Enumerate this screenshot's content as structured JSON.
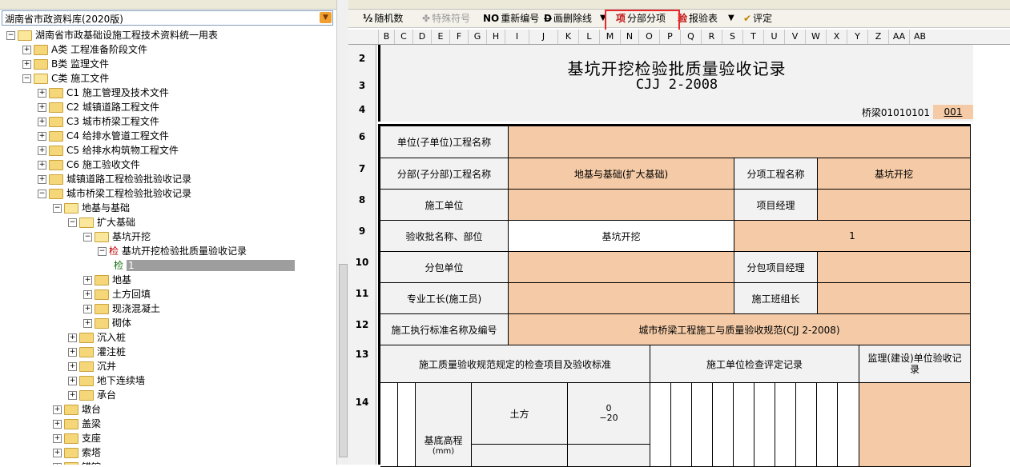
{
  "left_panel": {
    "library_combo": "湖南省市政资料库(2020版)",
    "tree": [
      {
        "label": "湖南省市政基础设施工程技术资料统一用表",
        "expander": "−",
        "icon": "open"
      },
      {
        "label": "A类 工程准备阶段文件",
        "expander": "+",
        "icon": "closed"
      },
      {
        "label": "B类 监理文件",
        "expander": "+",
        "icon": "closed"
      },
      {
        "label": "C类 施工文件",
        "expander": "−",
        "icon": "open"
      },
      {
        "label": "C1 施工管理及技术文件",
        "expander": "+",
        "icon": "closed"
      },
      {
        "label": "C2 城镇道路工程文件",
        "expander": "+",
        "icon": "closed"
      },
      {
        "label": "C3 城市桥梁工程文件",
        "expander": "+",
        "icon": "closed"
      },
      {
        "label": "C4 给排水管道工程文件",
        "expander": "+",
        "icon": "closed"
      },
      {
        "label": "C5 给排水构筑物工程文件",
        "expander": "+",
        "icon": "closed"
      },
      {
        "label": "C6 施工验收文件",
        "expander": "+",
        "icon": "closed"
      },
      {
        "label": "城镇道路工程检验批验收记录",
        "expander": "+",
        "icon": "closed"
      },
      {
        "label": "城市桥梁工程检验批验收记录",
        "expander": "−",
        "icon": "closed"
      },
      {
        "label": "地基与基础",
        "expander": "−",
        "icon": "open"
      },
      {
        "label": "扩大基础",
        "expander": "−",
        "icon": "open"
      },
      {
        "label": "基坑开挖",
        "expander": "−",
        "icon": "open"
      },
      {
        "label": "基坑开挖检验批质量验收记录",
        "expander": "−",
        "icon": "jian",
        "icon_text": "检"
      },
      {
        "label": "1",
        "expander": "",
        "icon": "jian-g",
        "icon_text": "检"
      },
      {
        "label": "地基",
        "expander": "+",
        "icon": "closed"
      },
      {
        "label": "土方回填",
        "expander": "+",
        "icon": "closed"
      },
      {
        "label": "现浇混凝土",
        "expander": "+",
        "icon": "closed"
      },
      {
        "label": "砌体",
        "expander": "+",
        "icon": "closed"
      },
      {
        "label": "沉入桩",
        "expander": "+",
        "icon": "closed"
      },
      {
        "label": "灌注桩",
        "expander": "+",
        "icon": "closed"
      },
      {
        "label": "沉井",
        "expander": "+",
        "icon": "closed"
      },
      {
        "label": "地下连续墙",
        "expander": "+",
        "icon": "closed"
      },
      {
        "label": "承台",
        "expander": "+",
        "icon": "closed"
      },
      {
        "label": "墩台",
        "expander": "+",
        "icon": "closed"
      },
      {
        "label": "盖梁",
        "expander": "+",
        "icon": "closed"
      },
      {
        "label": "支座",
        "expander": "+",
        "icon": "closed"
      },
      {
        "label": "索塔",
        "expander": "+",
        "icon": "closed"
      },
      {
        "label": "锚锭",
        "expander": "+",
        "icon": "closed"
      }
    ]
  },
  "toolbar": {
    "random_number": "随机数",
    "special_symbol": "特殊符号",
    "renumber_prefix": "NO",
    "renumber": "重新编号",
    "strike_prefix": "D",
    "strikethrough": "画删除线",
    "sub_item_icon": "项",
    "sub_item": "分部分项",
    "report_icon": "验",
    "report": "报验表",
    "evaluate": "评定"
  },
  "columns": [
    "B",
    "C",
    "D",
    "E",
    "F",
    "G",
    "H",
    "I",
    "J",
    "K",
    "L",
    "M",
    "N",
    "O",
    "P",
    "Q",
    "R",
    "S",
    "T",
    "U",
    "V",
    "W",
    "X",
    "Y",
    "Z",
    "AA",
    "AB"
  ],
  "rows": [
    "2",
    "3",
    "4",
    "6",
    "7",
    "8",
    "9",
    "10",
    "11",
    "12",
    "13",
    "14"
  ],
  "form": {
    "title": "基坑开挖检验批质量验收记录",
    "subtitle": "CJJ 2-2008",
    "code_label": "桥梁01010101",
    "code_value": "001",
    "unit_project_name_label": "单位(子单位)工程名称",
    "division_project_name_label": "分部(子分部)工程名称",
    "division_project_name_value": "地基与基础(扩大基础)",
    "item_project_name_label": "分项工程名称",
    "item_project_name_value": "基坑开挖",
    "construction_unit_label": "施工单位",
    "project_manager_label": "项目经理",
    "batch_name_label": "验收批名称、部位",
    "batch_name_value": "基坑开挖",
    "batch_number_value": "1",
    "subcontractor_label": "分包单位",
    "subcontract_manager_label": "分包项目经理",
    "foreman_label": "专业工长(施工员)",
    "team_leader_label": "施工班组长",
    "standard_label": "施工执行标准名称及编号",
    "standard_value": "城市桥梁工程施工与质量验收规范(CJJ 2-2008)",
    "check_items_header": "施工质量验收规范规定的检查项目及验收标准",
    "construction_check_header": "施工单位检查评定记录",
    "supervision_header": "监理(建设)单位验收记录",
    "base_elevation_label": "基底高程",
    "base_elevation_unit": "(mm)",
    "earthwork_label": "土方",
    "tolerance_upper": "0",
    "tolerance_lower": "−20"
  }
}
